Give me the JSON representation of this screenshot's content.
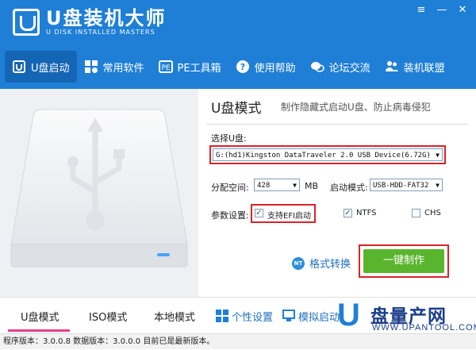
{
  "app": {
    "title": "U盘装机大师",
    "subtitle": "U DISK INSTALLED MASTERS",
    "window_buttons": [
      "≡",
      "—",
      "✕"
    ]
  },
  "nav": {
    "items": [
      {
        "label": "U盘启动",
        "icon": "usb-icon",
        "active": true
      },
      {
        "label": "常用软件",
        "icon": "apps-icon"
      },
      {
        "label": "PE工具箱",
        "icon": "pe-toolbox-icon"
      },
      {
        "label": "使用帮助",
        "icon": "help-icon"
      },
      {
        "label": "论坛交流",
        "icon": "chat-icon"
      },
      {
        "label": "装机联盟",
        "icon": "users-icon"
      }
    ]
  },
  "main": {
    "mode_title": "U盘模式",
    "mode_desc": "制作隐藏式启动U盘、防止病毒侵犯",
    "select_label": "选择U盘:",
    "device_value": "G:(hd1)Kingston DataTraveler 2.0 USB Device(6.72G)",
    "partition_label": "分配空间:",
    "partition_value": "428",
    "partition_unit": "MB",
    "boot_mode_label": "启动模式:",
    "boot_mode_value": "USB-HDD-FAT32",
    "params_label": "参数设置:",
    "options": [
      {
        "label": "支持EFI启动",
        "checked": true
      },
      {
        "label": "NTFS",
        "checked": true
      },
      {
        "label": "CHS",
        "checked": false
      }
    ],
    "format_badge": "NT",
    "format_label": "格式转换",
    "make_button": "一键制作"
  },
  "bottom": {
    "tabs": [
      "U盘模式",
      "ISO模式",
      "本地模式"
    ],
    "links": [
      "个性设置",
      "模拟启动"
    ],
    "watermark_logo": "U",
    "watermark_text": "盘量产网",
    "watermark_url": "WWW.UPANTOOL.COM"
  },
  "status": {
    "text": "程序版本：3.0.0.8  数据版本：3.0.0.0 目前已是最新版本。"
  },
  "colors": {
    "header_blue": "#1f7fd6",
    "active_nav": "#1565b5",
    "make_green": "#5ab52e",
    "highlight_red": "#d9232a",
    "tab_underline": "#e83e8c"
  }
}
